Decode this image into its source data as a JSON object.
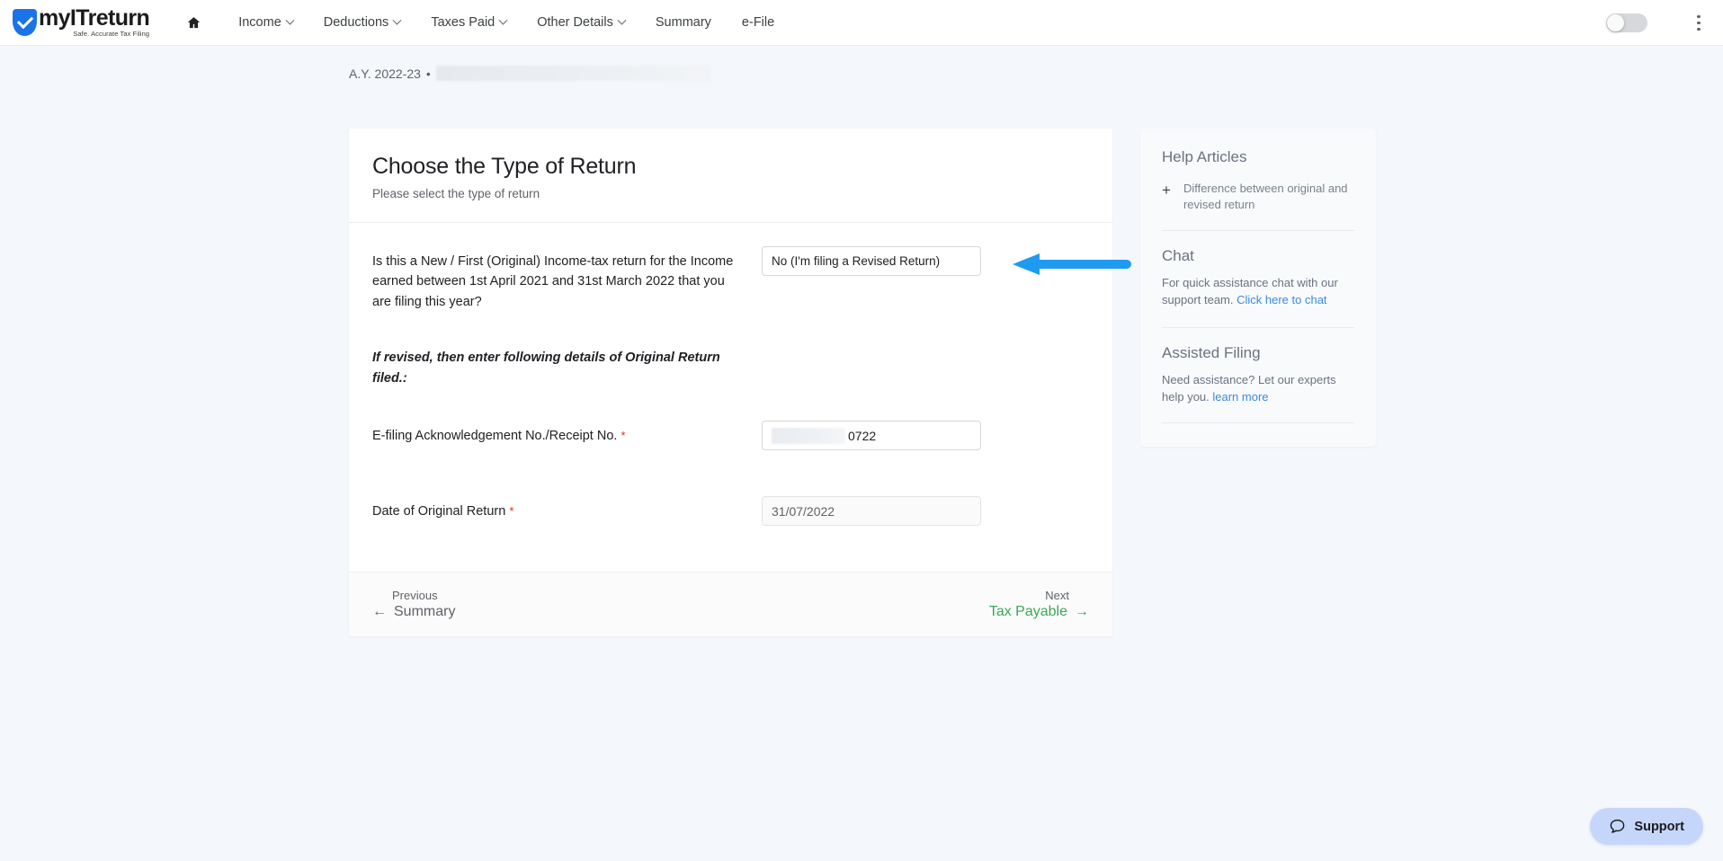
{
  "brand": {
    "name": "myITreturn",
    "tagline": "Safe. Accurate Tax Filing"
  },
  "topnav": {
    "home_label": "Home",
    "items": [
      {
        "label": "Income",
        "has_caret": true
      },
      {
        "label": "Deductions",
        "has_caret": true
      },
      {
        "label": "Taxes Paid",
        "has_caret": true
      },
      {
        "label": "Other Details",
        "has_caret": true
      },
      {
        "label": "Summary",
        "has_caret": false
      },
      {
        "label": "e-File",
        "has_caret": false
      }
    ],
    "toggle_state": "off",
    "menu_label": "More options"
  },
  "breadcrumb": {
    "assessment_year": "A.Y. 2022-23",
    "separator": "•",
    "redacted_user": ""
  },
  "card": {
    "title": "Choose the Type of Return",
    "subtitle": "Please select the type of return",
    "question": {
      "label": "Is this a New / First (Original) Income-tax return for the Income earned between 1st April 2021 and 31st March 2022 that you are filing this year?",
      "selected_value": "No (I'm filing a Revised Return)"
    },
    "revised_note": "If revised, then enter following details of Original Return filed.:",
    "ack_field": {
      "label": "E-filing Acknowledgement No./Receipt No.",
      "required_mark": "*",
      "value_visible": "0722",
      "value_masked": true
    },
    "date_field": {
      "label": "Date of Original Return",
      "required_mark": "*",
      "value": "31/07/2022"
    },
    "footer": {
      "previous_kicker": "Previous",
      "previous_label": "Summary",
      "previous_arrow": "←",
      "next_kicker": "Next",
      "next_label": "Tax Payable",
      "next_arrow": "→"
    }
  },
  "help_panel": {
    "articles_heading": "Help Articles",
    "article_1": "Difference between original and revised return",
    "chat_heading": "Chat",
    "chat_body": "For quick assistance chat with our support team. ",
    "chat_link": "Click here to chat",
    "assisted_heading": "Assisted Filing",
    "assisted_body": "Need assistance? Let our experts help you. ",
    "assisted_link": "learn more"
  },
  "support": {
    "label": "Support"
  },
  "colors": {
    "brand_blue": "#1a73e8",
    "annotation_arrow": "#1e9bf0",
    "next_green": "#3aa757",
    "link_blue": "#3b8bdb",
    "required_red": "#d93025",
    "page_bg": "#f4f7fb",
    "support_bg": "#c6d6fb"
  }
}
